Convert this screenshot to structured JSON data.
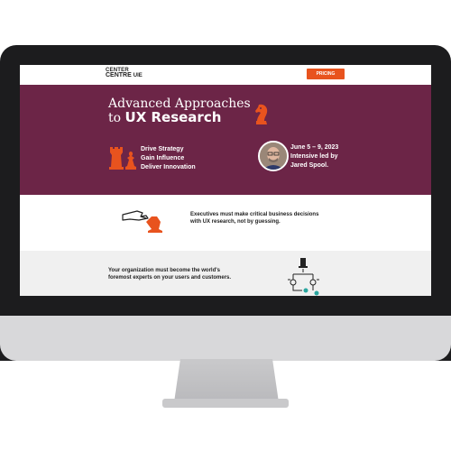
{
  "header": {
    "logo_line1": "CENTER",
    "logo_line2": "CENTRE",
    "logo_brand": "UIE",
    "pricing_label": "PRICING"
  },
  "hero": {
    "title_line1": "Advanced Approaches",
    "title_to": "to ",
    "title_bold": "UX Research",
    "bullets": [
      "Drive Strategy",
      "Gain Influence",
      "Deliver Innovation"
    ],
    "event_lines": [
      "June 5 – 9, 2023",
      "Intensive led by",
      "Jared Spool."
    ]
  },
  "band2": {
    "text_line1": "Executives must make critical business decisions",
    "text_line2": "with UX research, not by guessing."
  },
  "band3": {
    "text_line1": "Your organization must become the world's",
    "text_line2": "foremost experts on your users and customers."
  },
  "colors": {
    "hero_bg": "#6c2547",
    "accent_orange": "#e8531e",
    "teal_accent": "#2aa6a0"
  },
  "icons": [
    "knight-icon",
    "rooks-icon",
    "avatar",
    "hand-chess-piece-icon",
    "flowchart-icon"
  ]
}
